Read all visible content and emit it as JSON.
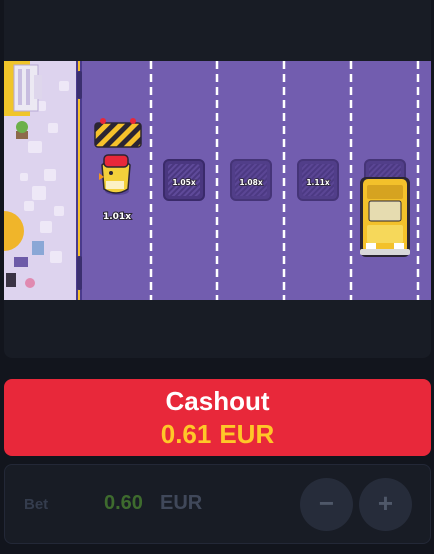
{
  "game": {
    "lane_multipliers": [
      "1.05x",
      "1.08x",
      "1.11x"
    ],
    "player_multiplier": "1.01x"
  },
  "cashout": {
    "title": "Cashout",
    "amount": "0.61",
    "currency": "EUR"
  },
  "bet": {
    "label": "Bet",
    "amount": "0.60",
    "currency": "EUR",
    "minus_symbol": "−",
    "plus_symbol": "+"
  },
  "colors": {
    "road": "#725daf",
    "sidewalk": "#ddd3ee",
    "cashout_button": "#e8283a",
    "cashout_amount": "#ffc728",
    "bet_amount": "#3e6b2e"
  }
}
